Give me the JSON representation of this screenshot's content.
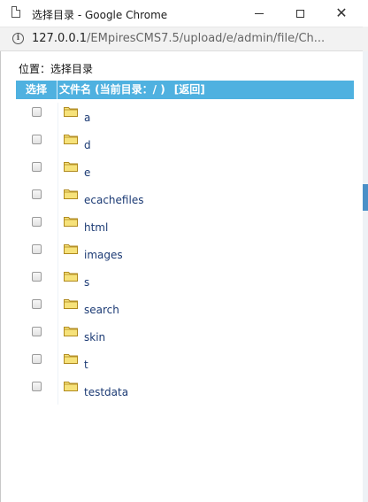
{
  "window": {
    "title": "选择目录 - Google Chrome",
    "minimize_icon": "minimize-icon",
    "maximize_icon": "maximize-icon",
    "close_icon": "close-icon",
    "close_glyph": "✕"
  },
  "address_bar": {
    "info_glyph": "i",
    "url_host": "127.0.0.1",
    "url_path": "/EMpiresCMS7.5/upload/e/admin/file/Ch..."
  },
  "page": {
    "location": "位置：选择目录",
    "table": {
      "col_select": "选择",
      "col_file": "文件名 (当前目录：/ )",
      "back_link": "[返回]"
    },
    "folders": [
      {
        "name": "a"
      },
      {
        "name": "d"
      },
      {
        "name": "e"
      },
      {
        "name": "ecachefiles"
      },
      {
        "name": "html"
      },
      {
        "name": "images"
      },
      {
        "name": "s"
      },
      {
        "name": "search"
      },
      {
        "name": "skin"
      },
      {
        "name": "t"
      },
      {
        "name": "testdata"
      }
    ]
  },
  "colors": {
    "header_blue": "#4fb1e0",
    "link_blue": "#1b3a74",
    "folder_yellow": "#f6e27a",
    "folder_outline": "#b08a1e"
  }
}
